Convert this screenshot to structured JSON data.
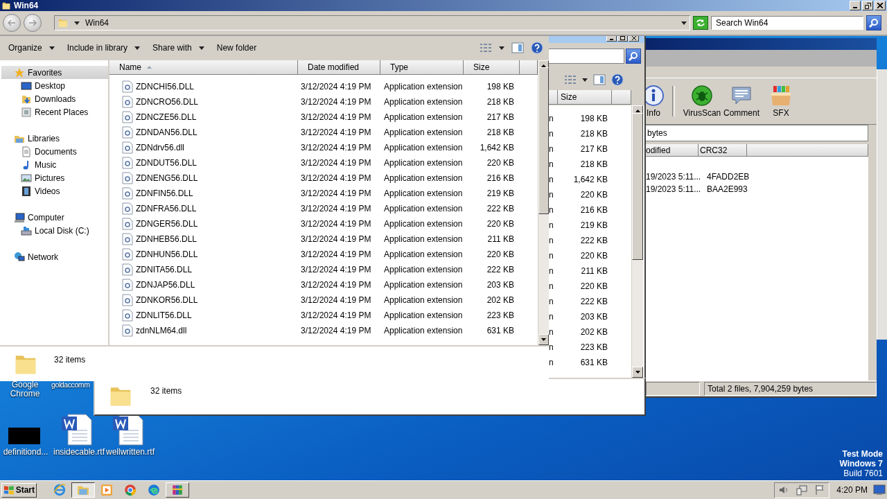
{
  "front_window": {
    "title": "Win64",
    "address": "Win64",
    "search": {
      "placeholder": "Search Win64"
    },
    "toolbar": [
      {
        "label": "Organize",
        "dropdown": true
      },
      {
        "label": "Include in library",
        "dropdown": true
      },
      {
        "label": "Share with",
        "dropdown": true
      },
      {
        "label": "New folder",
        "dropdown": false
      }
    ],
    "sidebar": [
      {
        "label": "Favorites",
        "kind": "favorites",
        "selected": true,
        "children": [
          {
            "label": "Desktop",
            "kind": "desktop",
            "selected": false
          },
          {
            "label": "Downloads",
            "kind": "downloads",
            "selected": false
          },
          {
            "label": "Recent Places",
            "kind": "recent",
            "selected": false
          }
        ]
      },
      {
        "label": "Libraries",
        "kind": "libraries",
        "selected": false,
        "children": [
          {
            "label": "Documents",
            "kind": "documents",
            "selected": false
          },
          {
            "label": "Music",
            "kind": "music",
            "selected": false
          },
          {
            "label": "Pictures",
            "kind": "pictures",
            "selected": false
          },
          {
            "label": "Videos",
            "kind": "videos",
            "selected": false
          }
        ]
      },
      {
        "label": "Computer",
        "kind": "computer",
        "selected": false,
        "children": [
          {
            "label": "Local Disk (C:)",
            "kind": "disk",
            "selected": false
          }
        ]
      },
      {
        "label": "Network",
        "kind": "network",
        "selected": false
      }
    ],
    "columns": [
      {
        "label": "Name",
        "sorted": true
      },
      {
        "label": "Date modified",
        "sorted": false
      },
      {
        "label": "Type",
        "sorted": false
      },
      {
        "label": "Size",
        "sorted": false
      }
    ],
    "rows": [
      {
        "name": "ZDNCHI56.DLL",
        "date": "3/12/2024 4:19 PM",
        "type": "Application extension",
        "size": "198 KB"
      },
      {
        "name": "ZDNCRO56.DLL",
        "date": "3/12/2024 4:19 PM",
        "type": "Application extension",
        "size": "218 KB"
      },
      {
        "name": "ZDNCZE56.DLL",
        "date": "3/12/2024 4:19 PM",
        "type": "Application extension",
        "size": "217 KB"
      },
      {
        "name": "ZDNDAN56.DLL",
        "date": "3/12/2024 4:19 PM",
        "type": "Application extension",
        "size": "218 KB"
      },
      {
        "name": "ZDNdrv56.dll",
        "date": "3/12/2024 4:19 PM",
        "type": "Application extension",
        "size": "1,642 KB"
      },
      {
        "name": "ZDNDUT56.DLL",
        "date": "3/12/2024 4:19 PM",
        "type": "Application extension",
        "size": "220 KB"
      },
      {
        "name": "ZDNENG56.DLL",
        "date": "3/12/2024 4:19 PM",
        "type": "Application extension",
        "size": "216 KB"
      },
      {
        "name": "ZDNFIN56.DLL",
        "date": "3/12/2024 4:19 PM",
        "type": "Application extension",
        "size": "219 KB"
      },
      {
        "name": "ZDNFRA56.DLL",
        "date": "3/12/2024 4:19 PM",
        "type": "Application extension",
        "size": "222 KB"
      },
      {
        "name": "ZDNGER56.DLL",
        "date": "3/12/2024 4:19 PM",
        "type": "Application extension",
        "size": "220 KB"
      },
      {
        "name": "ZDNHEB56.DLL",
        "date": "3/12/2024 4:19 PM",
        "type": "Application extension",
        "size": "211 KB"
      },
      {
        "name": "ZDNHUN56.DLL",
        "date": "3/12/2024 4:19 PM",
        "type": "Application extension",
        "size": "220 KB"
      },
      {
        "name": "ZDNITA56.DLL",
        "date": "3/12/2024 4:19 PM",
        "type": "Application extension",
        "size": "222 KB"
      },
      {
        "name": "ZDNJAP56.DLL",
        "date": "3/12/2024 4:19 PM",
        "type": "Application extension",
        "size": "203 KB"
      },
      {
        "name": "ZDNKOR56.DLL",
        "date": "3/12/2024 4:19 PM",
        "type": "Application extension",
        "size": "202 KB"
      },
      {
        "name": "ZDNLIT56.DLL",
        "date": "3/12/2024 4:19 PM",
        "type": "Application extension",
        "size": "223 KB"
      },
      {
        "name": "zdnNLM64.dll",
        "date": "3/12/2024 4:19 PM",
        "type": "Application extension",
        "size": "631 KB"
      }
    ],
    "status": "32 items"
  },
  "back_window": {
    "columns": [
      {
        "label": "Size"
      }
    ],
    "rows": [
      {
        "column_3": "n",
        "size": "198 KB"
      },
      {
        "column_3": "n",
        "size": "218 KB"
      },
      {
        "column_3": "n",
        "size": "217 KB"
      },
      {
        "column_3": "n",
        "size": "218 KB"
      },
      {
        "column_3": "n",
        "size": "1,642 KB"
      },
      {
        "column_3": "n",
        "size": "220 KB"
      },
      {
        "column_3": "n",
        "size": "216 KB"
      },
      {
        "column_3": "n",
        "size": "219 KB"
      },
      {
        "column_3": "n",
        "size": "222 KB"
      },
      {
        "column_3": "n",
        "size": "220 KB"
      },
      {
        "column_3": "n",
        "size": "211 KB"
      },
      {
        "column_3": "n",
        "size": "220 KB"
      },
      {
        "column_3": "n",
        "size": "222 KB"
      },
      {
        "column_3": "n",
        "size": "203 KB"
      },
      {
        "column_3": "n",
        "size": "202 KB"
      },
      {
        "column_3": "n",
        "size": "223 KB"
      },
      {
        "column_3": "n",
        "size": "631 KB"
      }
    ],
    "status": "32 items"
  },
  "winrar": {
    "toolbar": [
      {
        "label": "Info",
        "kind": "info"
      },
      {
        "label": "VirusScan",
        "kind": "virusscan"
      },
      {
        "label": "Comment",
        "kind": "comment"
      },
      {
        "label": "SFX",
        "kind": "sfx"
      }
    ],
    "address": "bytes",
    "columns": [
      {
        "label": "odified"
      },
      {
        "label": "CRC32"
      }
    ],
    "rows": [
      {
        "column_1": "19/2023 5:11...",
        "crc32": "4FADD2EB"
      },
      {
        "column_1": "19/2023 5:11...",
        "crc32": "BAA2E993"
      }
    ],
    "status": "Total 2 files, 7,904,259 bytes"
  },
  "desktop": {
    "icons": [
      {
        "label": "Google Chrome",
        "kind": "covered"
      },
      {
        "label": "goldaccomm",
        "kind": "covered"
      },
      {
        "label": "definitiond...",
        "kind": "thumbnail"
      },
      {
        "label": "insidecable.rtf",
        "kind": "document"
      },
      {
        "label": "wellwritten.rtf",
        "kind": "document"
      }
    ],
    "os_notice": [
      "Test Mode",
      "Windows 7",
      "Build 7601"
    ]
  },
  "taskbar": {
    "start": "Start",
    "apps": [
      {
        "kind": "ie",
        "open": false,
        "selected": false
      },
      {
        "kind": "explorer",
        "open": true,
        "selected": true
      },
      {
        "kind": "media",
        "open": false,
        "selected": false
      },
      {
        "kind": "chrome",
        "open": false,
        "selected": false
      },
      {
        "kind": "edge",
        "open": false,
        "selected": false
      },
      {
        "kind": "winrar",
        "open": true,
        "selected": false
      }
    ],
    "clock": "4:20 PM"
  }
}
